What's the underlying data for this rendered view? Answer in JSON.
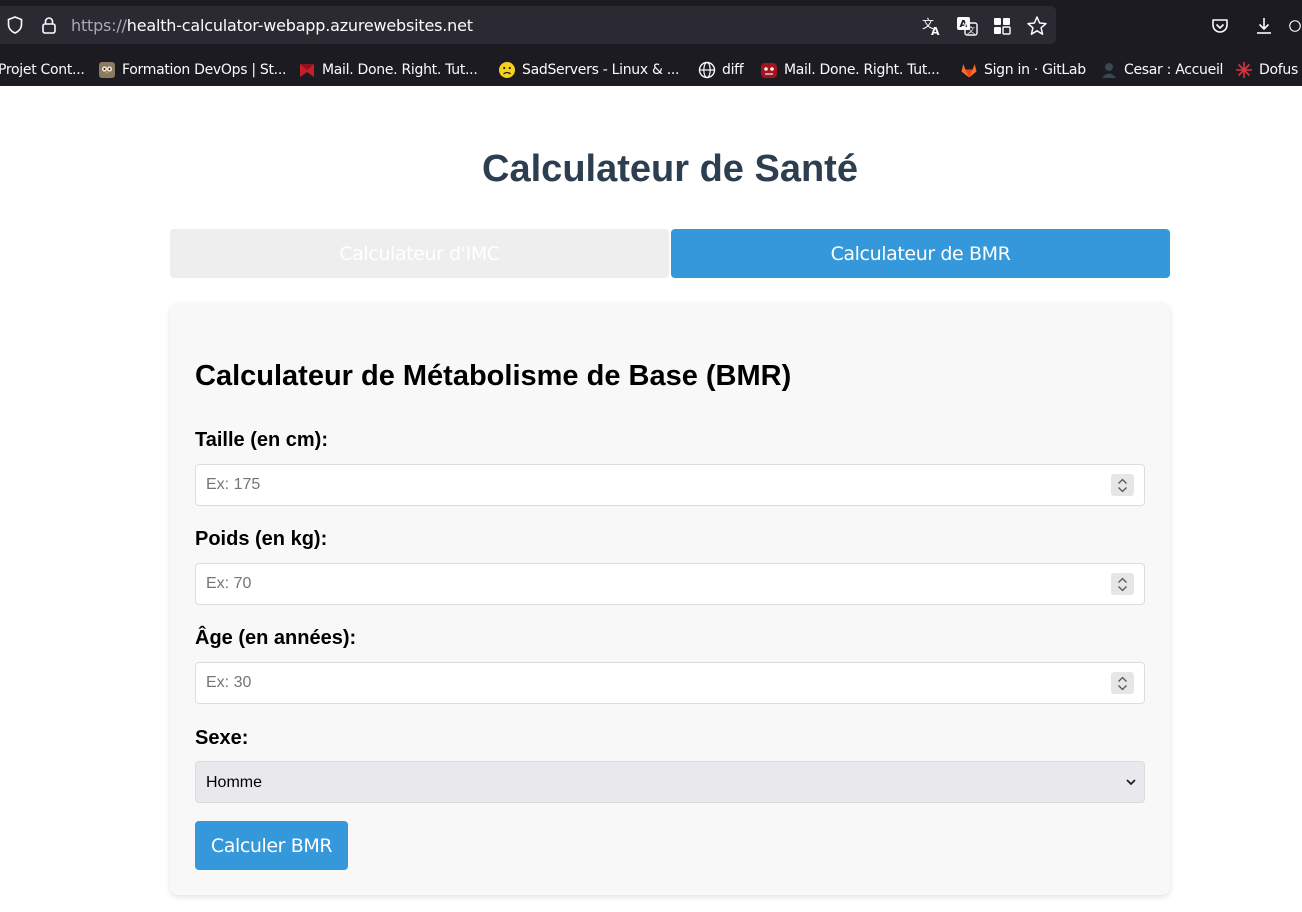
{
  "browser": {
    "url_protocol": "https://",
    "url_host": "health-calculator-webapp.azurewebsites.net",
    "bookmarks": [
      {
        "label": "Projet Cont...",
        "icon": "none"
      },
      {
        "label": "Formation DevOps | St...",
        "icon": "owl-icon"
      },
      {
        "label": "Mail. Done. Right. Tut...",
        "icon": "mail-flag-icon"
      },
      {
        "label": "SadServers - Linux & ...",
        "icon": "sad-face-icon"
      },
      {
        "label": "diff",
        "icon": "globe-icon"
      },
      {
        "label": "Mail. Done. Right. Tut...",
        "icon": "mail-mascot-icon"
      },
      {
        "label": "Sign in · GitLab",
        "icon": "gitlab-icon"
      },
      {
        "label": "Cesar : Accueil",
        "icon": "cesar-icon"
      },
      {
        "label": "Dofus",
        "icon": "dofus-icon"
      }
    ]
  },
  "page": {
    "title": "Calculateur de Santé",
    "tabs": [
      {
        "label": "Calculateur d'IMC",
        "active": false
      },
      {
        "label": "Calculateur de BMR",
        "active": true
      }
    ]
  },
  "bmr_form": {
    "title": "Calculateur de Métabolisme de Base (BMR)",
    "height": {
      "label": "Taille (en cm):",
      "placeholder": "Ex: 175",
      "value": ""
    },
    "weight": {
      "label": "Poids (en kg):",
      "placeholder": "Ex: 70",
      "value": ""
    },
    "age": {
      "label": "Âge (en années):",
      "placeholder": "Ex: 30",
      "value": ""
    },
    "sex": {
      "label": "Sexe:",
      "selected": "Homme"
    },
    "submit_label": "Calculer BMR"
  },
  "colors": {
    "accent": "#3498db",
    "title": "#2c3e50",
    "card_bg": "#f8f8f8",
    "chrome_bg": "#1c1b22",
    "urlbar_bg": "#2b2a33"
  }
}
